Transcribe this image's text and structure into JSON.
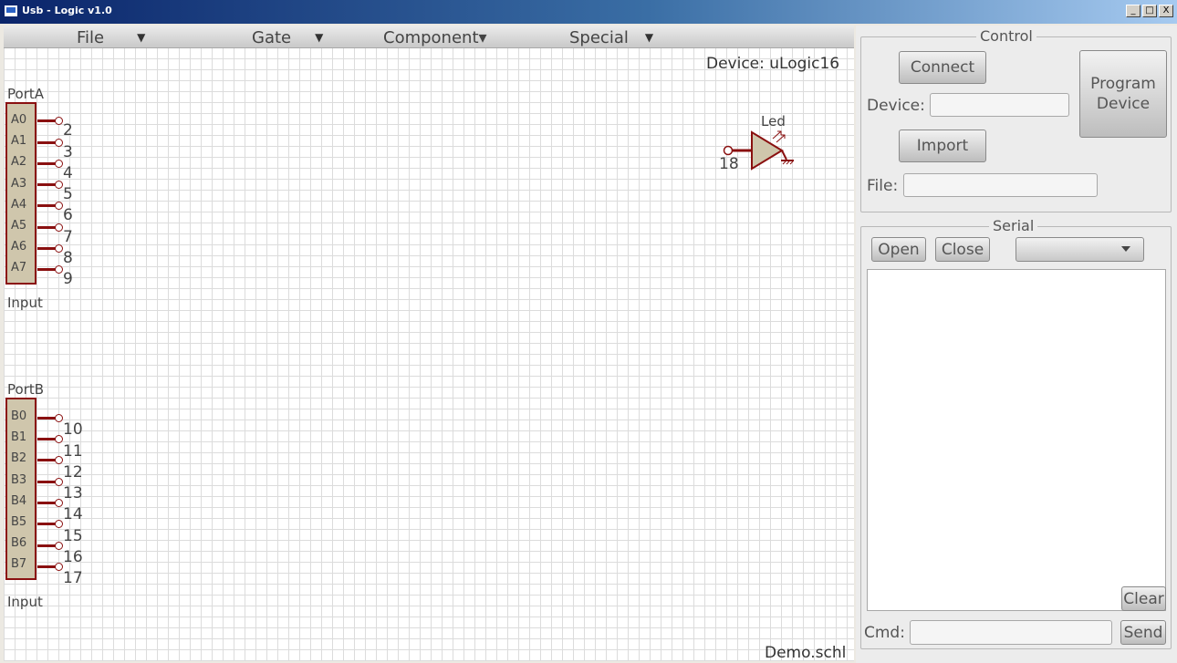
{
  "window": {
    "title": "Usb - Logic v1.0",
    "controls": [
      "_",
      "□",
      "X"
    ]
  },
  "menu": [
    {
      "label": "File",
      "caret": "▼"
    },
    {
      "label": "Gate",
      "caret": "▼"
    },
    {
      "label": "Component▾",
      "caret": ""
    },
    {
      "label": "Special",
      "caret": "▼"
    }
  ],
  "canvas": {
    "device_label": "Device: uLogic16",
    "file_name": "Demo.schl",
    "port_a": {
      "title": "PortA",
      "footer": "Input",
      "pins": [
        "A0",
        "A1",
        "A2",
        "A3",
        "A4",
        "A5",
        "A6",
        "A7"
      ],
      "numbers": [
        "2",
        "3",
        "4",
        "5",
        "6",
        "7",
        "8",
        "9"
      ]
    },
    "port_b": {
      "title": "PortB",
      "footer": "Input",
      "pins": [
        "B0",
        "B1",
        "B2",
        "B3",
        "B4",
        "B5",
        "B6",
        "B7"
      ],
      "numbers": [
        "10",
        "11",
        "12",
        "13",
        "14",
        "15",
        "16",
        "17"
      ]
    },
    "led": {
      "label": "Led",
      "number": "18"
    }
  },
  "control": {
    "title": "Control",
    "connect": "Connect",
    "program": "Program Device",
    "device_label": "Device:",
    "device_value": "",
    "import": "Import",
    "file_label": "File:",
    "file_value": ""
  },
  "serial": {
    "title": "Serial",
    "open": "Open",
    "close": "Close",
    "port_value": "",
    "clear": "Clear",
    "cmd_label": "Cmd:",
    "cmd_value": "",
    "send": "Send"
  },
  "colors": {
    "wire": "#8a1010",
    "port_fill": "#cfc6ac",
    "grid": "#dcdcdc"
  }
}
